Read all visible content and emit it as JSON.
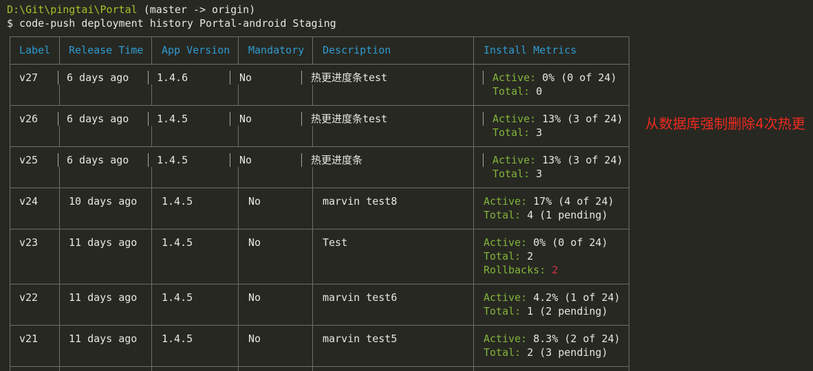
{
  "terminal": {
    "path": "D:\\Git\\pingtai\\Portal",
    "branch": "(master -> origin)",
    "command": "$ code-push deployment history Portal-android Staging"
  },
  "table": {
    "headers": [
      "Label",
      "Release Time",
      "App Version",
      "Mandatory",
      "Description",
      "Install Metrics"
    ],
    "rows": [
      {
        "label": "v27",
        "release_time": "6 days ago",
        "app_version": "1.4.6",
        "mandatory": "No",
        "description": "热更进度条test",
        "active_label": "Active:",
        "active_value": "0% (0 of 24)",
        "total_label": "Total:",
        "total_value": "0"
      },
      {
        "label": "v26",
        "release_time": "6 days ago",
        "app_version": "1.4.5",
        "mandatory": "No",
        "description": "热更进度条test",
        "active_label": "Active:",
        "active_value": "13% (3 of 24)",
        "total_label": "Total:",
        "total_value": "3"
      },
      {
        "label": "v25",
        "release_time": "6 days ago",
        "app_version": "1.4.5",
        "mandatory": "No",
        "description": "热更进度条",
        "active_label": "Active:",
        "active_value": "13% (3 of 24)",
        "total_label": "Total:",
        "total_value": "3"
      },
      {
        "label": "v24",
        "release_time": "10 days ago",
        "app_version": "1.4.5",
        "mandatory": "No",
        "description": "marvin test8",
        "active_label": "Active:",
        "active_value": "17% (4 of 24)",
        "total_label": "Total:",
        "total_value": "4 (1 pending)"
      },
      {
        "label": "v23",
        "release_time": "11 days ago",
        "app_version": "1.4.5",
        "mandatory": "No",
        "description": "Test",
        "active_label": "Active:",
        "active_value": "0% (0 of 24)",
        "total_label": "Total:",
        "total_value": "2",
        "rollbacks_label": "Rollbacks:",
        "rollbacks_value": "2"
      },
      {
        "label": "v22",
        "release_time": "11 days ago",
        "app_version": "1.4.5",
        "mandatory": "No",
        "description": "marvin test6",
        "active_label": "Active:",
        "active_value": "4.2% (1 of 24)",
        "total_label": "Total:",
        "total_value": "1 (2 pending)"
      },
      {
        "label": "v21",
        "release_time": "11 days ago",
        "app_version": "1.4.5",
        "mandatory": "No",
        "description": "marvin test5",
        "active_label": "Active:",
        "active_value": "8.3% (2 of 24)",
        "total_label": "Total:",
        "total_value": "2 (3 pending)"
      }
    ]
  },
  "annotation": "从数据库强制删除4次热更",
  "colors": {
    "background": "#272822",
    "header": "#2f9bd1",
    "path": "#a6c32a",
    "metric_label": "#82b43a",
    "rollback_value": "#d9304a",
    "annotation": "#ec2a20"
  }
}
